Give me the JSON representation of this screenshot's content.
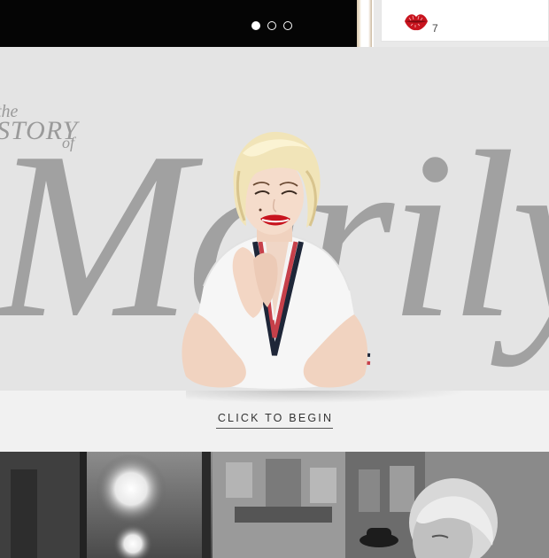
{
  "slider": {
    "dots": [
      "active",
      "inactive",
      "inactive"
    ]
  },
  "like_card": {
    "icon": "lips-kiss-icon",
    "count": "7",
    "accent": "#c8141e"
  },
  "hero": {
    "title_the": "the",
    "title_story": "STORY",
    "title_of": "of",
    "title_name": "Marilyn",
    "background": "#e4e4e4",
    "title_color": "#a1a1a1"
  },
  "cta": {
    "label": "CLICK TO BEGIN"
  },
  "bottom_photo": {
    "style": "black-and-white street photograph"
  }
}
